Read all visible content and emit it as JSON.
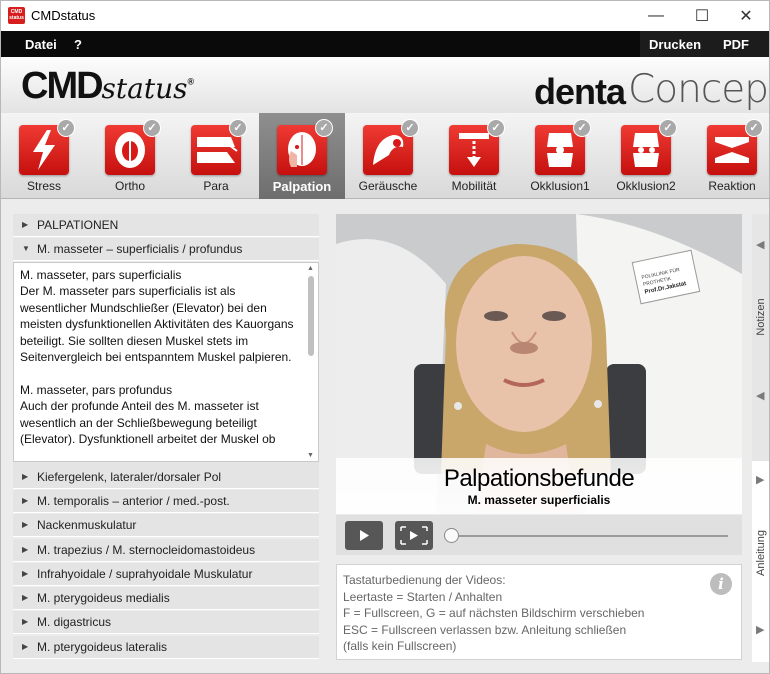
{
  "window": {
    "title": "CMDstatus",
    "app_icon_text": "CMD status",
    "minimize_glyph": "—",
    "maximize_glyph": "☐",
    "close_glyph": "✕"
  },
  "menu": {
    "datei": "Datei",
    "help": "?",
    "drucken": "Drucken",
    "pdf": "PDF"
  },
  "banner": {
    "logo_bold": "CMD",
    "logo_script": "status",
    "logo_mark": "®",
    "brand_denta": "denta",
    "brand_concept": "Concept",
    "brand_mark": "®"
  },
  "tabs": [
    {
      "label": "Stress",
      "icon": "lightning-icon",
      "check": "✓"
    },
    {
      "label": "Ortho",
      "icon": "skull-icon",
      "check": "✓"
    },
    {
      "label": "Para",
      "icon": "teeth-grinding-icon",
      "check": "✓"
    },
    {
      "label": "Palpation",
      "icon": "head-palpation-icon",
      "check": "✓"
    },
    {
      "label": "Geräusche",
      "icon": "joint-sound-icon",
      "check": "✓"
    },
    {
      "label": "Mobilität",
      "icon": "mobility-icon",
      "check": "✓"
    },
    {
      "label": "Okklusion1",
      "icon": "occlusion-icon",
      "check": "✓"
    },
    {
      "label": "Okklusion2",
      "icon": "occlusion2-icon",
      "check": "✓"
    },
    {
      "label": "Reaktion",
      "icon": "reaction-icon",
      "check": "✓"
    }
  ],
  "accordion": {
    "top_section": "PALPATIONEN",
    "open_section": "M. masseter – superficialis / profundus",
    "open_content": "M. masseter, pars superficialis\nDer M. masseter pars superficialis ist als wesentlicher Mundschließer (Elevator) bei den meisten dysfunktionellen Aktivitäten des Kauorgans beteiligt. Sie sollten diesen Muskel stets im Seitenvergleich bei entspanntem Muskel palpieren.\n\nM. masseter, pars profundus\nAuch der profunde Anteil des M. masseter ist wesentlich an der Schließbewegung beteiligt (Elevator). Dysfunktionell arbeitet der Muskel ob",
    "sections": [
      "Kiefergelenk, lateraler/dorsaler Pol",
      "M. temporalis – anterior / med.-post.",
      "Nackenmuskulatur",
      "M. trapezius / M. sternocleidomastoideus",
      "Infrahyoidale / suprahyoidale Muskulatur",
      "M. pterygoideus medialis",
      "M. digastricus",
      "M. pterygoideus lateralis"
    ],
    "open_glyph": "▼",
    "closed_glyph": "▶"
  },
  "video": {
    "caption_title": "Palpationsbefunde",
    "caption_subtitle": "M. masseter superficialis",
    "badge_line1": "POLIKLINIK FÜR",
    "badge_line2": "PROTHETIK",
    "badge_line3": "Prof.Dr.Jakstat",
    "progress": 0.0
  },
  "help": {
    "text": "Tastaturbedienung der Videos:\nLeertaste = Starten / Anhalten\nF = Fullscreen, G = auf nächsten Bildschirm verschieben\nESC = Fullscreen verlassen bzw. Anleitung schließen\n(falls kein Fullscreen)",
    "info_glyph": "i"
  },
  "side": {
    "notizen": "Notizen",
    "anleitung": "Anleitung",
    "arrow_left": "◀",
    "arrow_right": "▶"
  },
  "colors": {
    "accent_red": "#d71a18",
    "menu_bar": "#0a0a0a",
    "active_tab": "#7c7c7c"
  }
}
